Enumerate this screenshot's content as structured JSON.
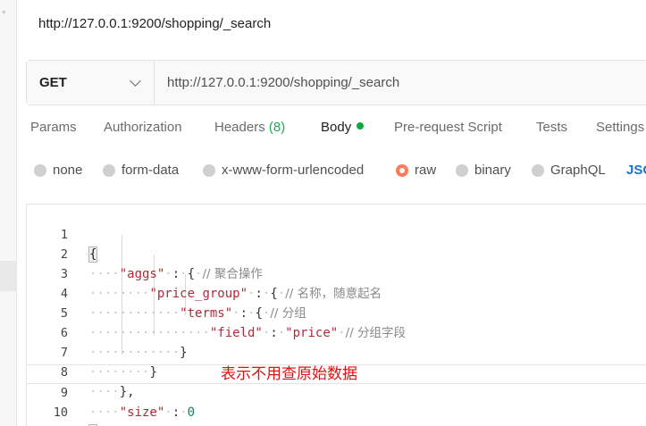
{
  "request": {
    "title": "http://127.0.0.1:9200/shopping/_search",
    "method": "GET",
    "url": "http://127.0.0.1:9200/shopping/_search"
  },
  "tabs": [
    {
      "label": "Params"
    },
    {
      "label": "Authorization"
    },
    {
      "label": "Headers",
      "count": "(8)"
    },
    {
      "label": "Body",
      "active": true
    },
    {
      "label": "Pre-request Script"
    },
    {
      "label": "Tests"
    },
    {
      "label": "Settings"
    }
  ],
  "body_types": [
    {
      "label": "none"
    },
    {
      "label": "form-data"
    },
    {
      "label": "x-www-form-urlencoded"
    },
    {
      "label": "raw",
      "selected": true
    },
    {
      "label": "binary"
    },
    {
      "label": "GraphQL"
    },
    {
      "label": "JSON"
    }
  ],
  "editor": {
    "line_numbers": [
      "1",
      "2",
      "3",
      "4",
      "5",
      "6",
      "7",
      "8",
      "9",
      "10"
    ],
    "lines": {
      "l2_key": "\"aggs\"",
      "l2_comment": "// 聚合操作",
      "l3_key": "\"price_group\"",
      "l3_comment": "// 名称，随意起名",
      "l4_key": "\"terms\"",
      "l4_comment": "// 分组",
      "l5_key": "\"field\"",
      "l5_value": "\"price\"",
      "l5_comment": "// 分组字段",
      "l9_key": "\"size\"",
      "l9_value": "0"
    },
    "annotation": "表示不用查原始数据"
  },
  "colors": {
    "active_dot": "#0caa41",
    "headers_count": "#26a65b",
    "raw_radio": "#ff7a59",
    "json_link": "#1a73c9",
    "annotation": "#e01010"
  }
}
